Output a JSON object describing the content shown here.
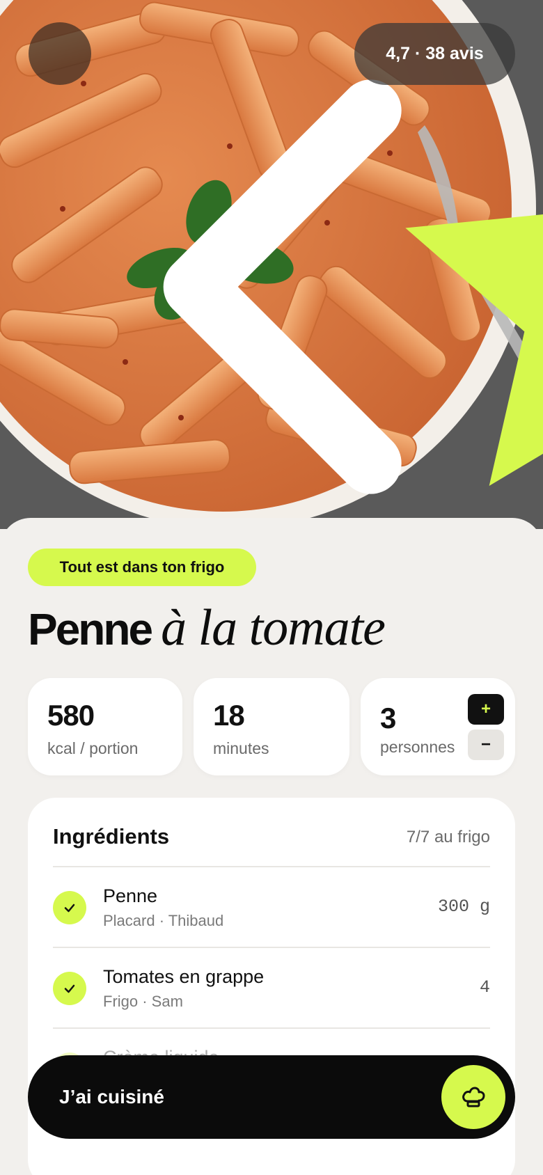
{
  "hero": {
    "image_name": "penne-photo",
    "back_icon": "chevron-left-icon",
    "rating": {
      "icon": "star-icon",
      "text": "4,7 · 38 avis"
    }
  },
  "tag": "Tout est dans ton frigo",
  "title": {
    "bold": "Penne",
    "italic": "à la tomate"
  },
  "stats": {
    "calories": {
      "value": "580",
      "label": "kcal / portion"
    },
    "time": {
      "value": "18",
      "label": "minutes"
    },
    "servings": {
      "value": "3",
      "label": "personnes",
      "plus": "+",
      "minus": "−"
    }
  },
  "ingredients": {
    "title": "Ingrédients",
    "count": "7/7 au frigo",
    "items": [
      {
        "name": "Penne",
        "location": "Placard · Thibaud",
        "qty": "300 g"
      },
      {
        "name": "Tomates en grappe",
        "location": "Frigo · Sam",
        "qty": "4"
      },
      {
        "name": "Crème liquide",
        "location": "",
        "qty": ""
      }
    ]
  },
  "cook_button": {
    "label": "J’ai cuisiné",
    "icon": "chef-hat-icon"
  },
  "colors": {
    "accent": "#d6f94d",
    "dark": "#0b0b0b",
    "background": "#f2f0ed"
  }
}
